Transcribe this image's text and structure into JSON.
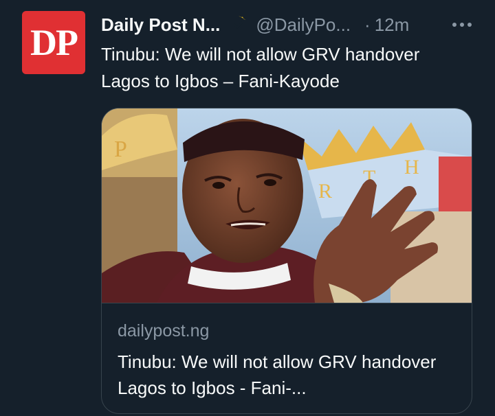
{
  "tweet": {
    "avatar_text": "DP",
    "display_name": "Daily Post N...",
    "handle": "@DailyPo...",
    "separator": "·",
    "timestamp": "12m",
    "text": "Tinubu: We will not allow GRV handover Lagos to Igbos – Fani-Kayode"
  },
  "card": {
    "domain": "dailypost.ng",
    "title": "Tinubu: We will not allow GRV handover Lagos to Igbos - Fani-..."
  },
  "icons": {
    "verified": "verified-badge-icon",
    "more": "more-icon"
  },
  "colors": {
    "background": "#15202b",
    "avatar": "#e03033",
    "badge": "#e2b719",
    "secondary_text": "#8b98a5",
    "border": "#38444d"
  }
}
